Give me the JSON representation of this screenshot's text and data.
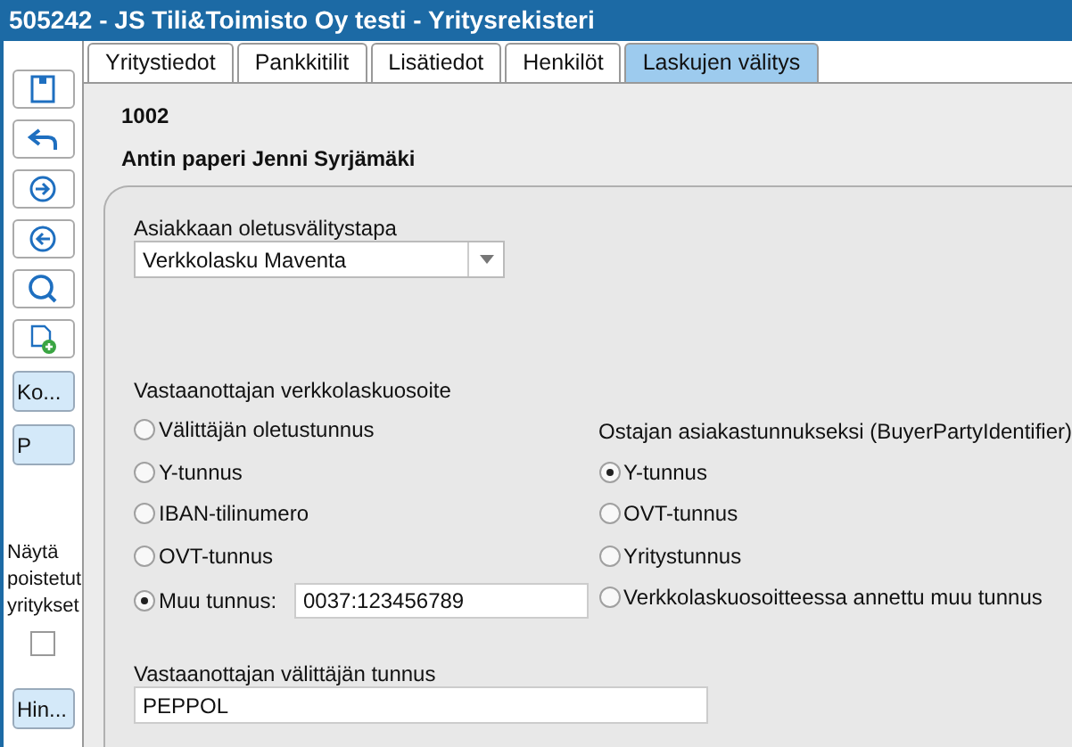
{
  "window": {
    "title": "505242 - JS Tili&Toimisto Oy testi - Yritysrekisteri"
  },
  "sidebar": {
    "buttons": [
      {
        "kind": "save"
      },
      {
        "kind": "undo"
      },
      {
        "kind": "next"
      },
      {
        "kind": "prev"
      },
      {
        "kind": "search"
      },
      {
        "kind": "new"
      },
      {
        "kind": "text",
        "label": "Ko..."
      },
      {
        "kind": "text",
        "label": "P"
      }
    ],
    "show_deleted": {
      "label": "Näytä poistetut yritykset",
      "checked": false
    },
    "bottom_button": "Hin..."
  },
  "tabs": [
    {
      "label": "Yritystiedot",
      "selected": false
    },
    {
      "label": "Pankkitilit",
      "selected": false
    },
    {
      "label": "Lisätiedot",
      "selected": false
    },
    {
      "label": "Henkilöt",
      "selected": false
    },
    {
      "label": "Laskujen välitys",
      "selected": true
    }
  ],
  "company_number": "1002",
  "company_name": "Antin paperi Jenni Syrjämäki",
  "default_method": {
    "label": "Asiakkaan oletusvälitystapa",
    "value": "Verkkolasku Maventa"
  },
  "recipient_address": {
    "label": "Vastaanottajan verkkolaskuosoite",
    "options": [
      {
        "label": "Välittäjän oletustunnus",
        "selected": false
      },
      {
        "label": "Y-tunnus",
        "selected": false
      },
      {
        "label": "IBAN-tilinumero",
        "selected": false
      },
      {
        "label": "OVT-tunnus",
        "selected": false
      },
      {
        "label": "Muu tunnus:",
        "selected": true,
        "value": "0037:123456789"
      }
    ]
  },
  "buyer_identifier": {
    "label": "Ostajan asiakastunnukseksi (BuyerPartyIdentifier)",
    "options": [
      {
        "label": "Y-tunnus",
        "selected": true
      },
      {
        "label": "OVT-tunnus",
        "selected": false
      },
      {
        "label": "Yritystunnus",
        "selected": false
      },
      {
        "label": "Verkkolaskuosoitteessa annettu muu tunnus",
        "selected": false
      }
    ]
  },
  "operator": {
    "label": "Vastaanottajan välittäjän tunnus",
    "value": "PEPPOL"
  }
}
